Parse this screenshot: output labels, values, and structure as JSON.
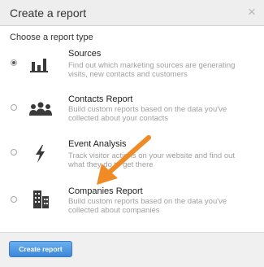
{
  "dialog": {
    "title": "Create a report",
    "close_glyph": "×",
    "section_label": "Choose a report type"
  },
  "options": [
    {
      "title": "Sources",
      "desc_line1": "Find out which marketing sources are generating",
      "desc_line2": "visits, new contacts and customers",
      "icon": "bar-chart-icon",
      "selected": true
    },
    {
      "title": "Contacts Report",
      "desc_line1": "Build custom reports based on the data you've",
      "desc_line2": "collected about your contacts",
      "icon": "people-icon",
      "selected": false
    },
    {
      "title": "Event Analysis",
      "desc_line1": "Track visitor actions on your website and find out",
      "desc_line2": "what they do to get there",
      "icon": "lightning-bolt-icon",
      "selected": false
    },
    {
      "title": "Companies Report",
      "desc_line1": "Build custom reports based on the data you've",
      "desc_line2": "collected about companies",
      "icon": "buildings-icon",
      "selected": false
    }
  ],
  "footer": {
    "create_label": "Create report"
  },
  "colors": {
    "accent_button": "#3d87d8",
    "annotation_arrow": "#f08a24"
  }
}
